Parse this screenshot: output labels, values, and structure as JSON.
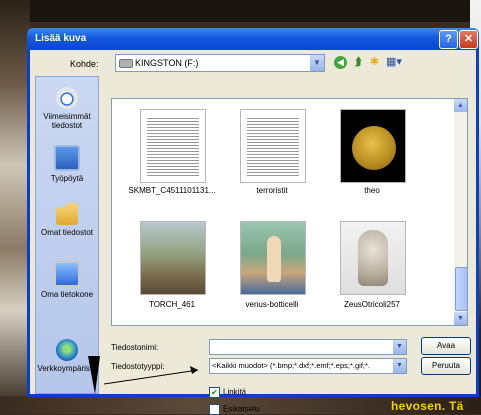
{
  "window": {
    "title": "Lisää kuva"
  },
  "toolbar": {
    "look_in_label": "Kohde:",
    "path_value": "KINGSTON (F:)",
    "icons": [
      "back-icon",
      "up-folder-icon",
      "new-folder-icon",
      "view-menu-icon"
    ]
  },
  "places": [
    {
      "label": "Viimeisimmät tiedostot",
      "icon": "recent-documents-icon"
    },
    {
      "label": "Työpöytä",
      "icon": "desktop-icon"
    },
    {
      "label": "Omat tiedostot",
      "icon": "my-documents-icon"
    },
    {
      "label": "Oma tietokone",
      "icon": "my-computer-icon"
    },
    {
      "label": "Verkkoympäristö",
      "icon": "network-places-icon"
    }
  ],
  "files": [
    {
      "name": "SKMBT_C4511101131..."
    },
    {
      "name": "terroristit"
    },
    {
      "name": "theo"
    },
    {
      "name": "TORCH_461"
    },
    {
      "name": "venus-botticelli"
    },
    {
      "name": "ZeusOtricoli257"
    }
  ],
  "filename": {
    "label": "Tiedostonimi:",
    "value": ""
  },
  "filetype": {
    "label": "Tiedostotyyppi:",
    "value": "<Kaikki muodot> (*.bmp;*.dxf;*.emf;*.eps;*.gif;*."
  },
  "buttons": {
    "open": "Avaa",
    "cancel": "Peruuta"
  },
  "options": {
    "link_label": "Linkitä",
    "link_checked": true,
    "preview_label": "Esikatselu",
    "preview_checked": false
  },
  "background": {
    "caption": "hevosen. Tä"
  },
  "colors": {
    "titlebar": "#0b46cf",
    "dialog": "#ece9d8",
    "caption": "#f0d400"
  }
}
